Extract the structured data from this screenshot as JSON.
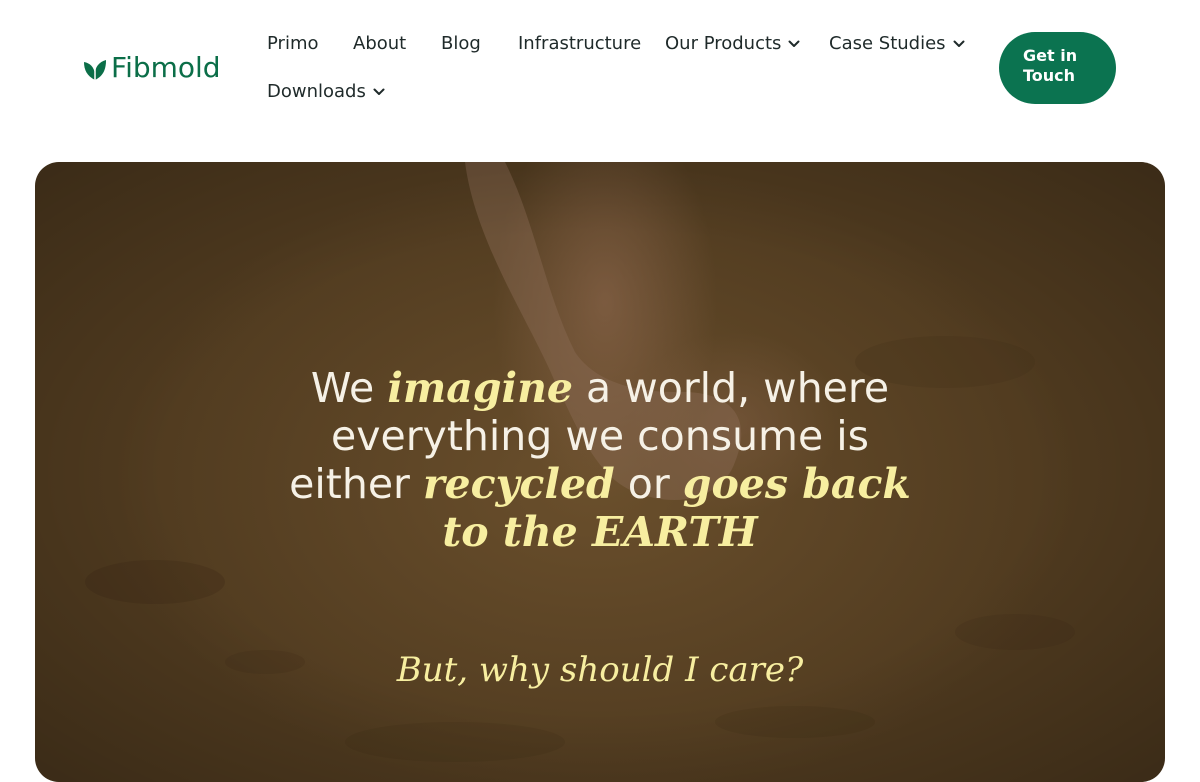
{
  "brand": {
    "name": "Fibmold",
    "color": "#0b6e48"
  },
  "nav": {
    "items": [
      {
        "label": "Primo",
        "has_dropdown": false
      },
      {
        "label": "About",
        "has_dropdown": false
      },
      {
        "label": "Blog",
        "has_dropdown": false
      },
      {
        "label": "Infrastructure",
        "has_dropdown": false
      },
      {
        "label": "Our Products",
        "has_dropdown": true,
        "icon": "chevron-down-icon"
      },
      {
        "label": "Case Studies",
        "has_dropdown": true,
        "icon": "chevron-down-icon"
      },
      {
        "label": "Downloads",
        "has_dropdown": true,
        "icon": "chevron-down-icon"
      }
    ],
    "cta_label": "Get in Touch",
    "cta_color": "#0b7350"
  },
  "hero": {
    "headline": {
      "part1": "We",
      "emph1": "imagine",
      "part2": "a world, where everything we consume is either",
      "emph2": "recycled",
      "part3": "or",
      "emph3": "goes back to the EARTH"
    },
    "question": "But, why should I care?",
    "text_color": "#f6f1e6",
    "accent_color": "#f7eea0"
  }
}
